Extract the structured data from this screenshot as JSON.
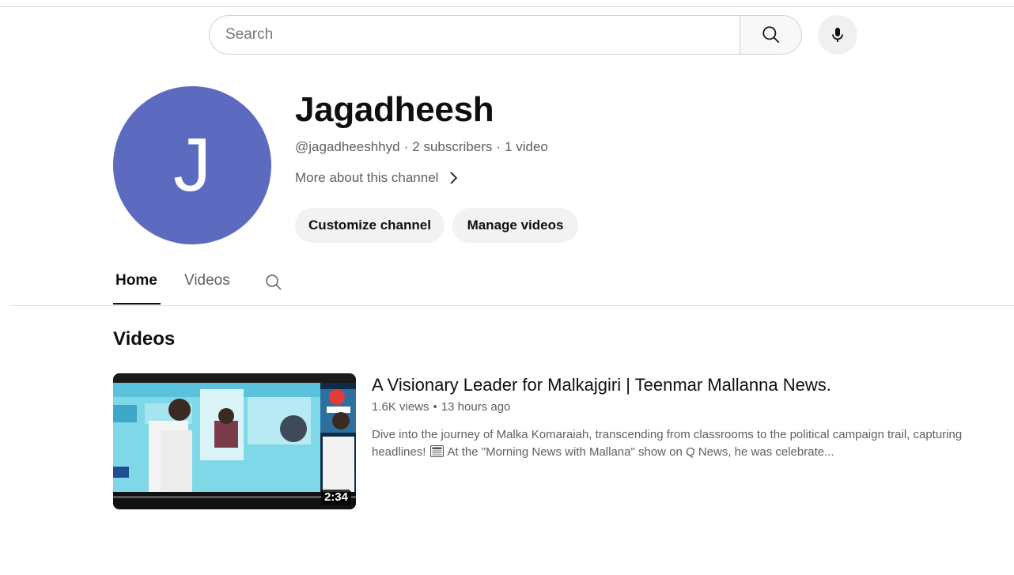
{
  "search": {
    "placeholder": "Search"
  },
  "icons": {
    "search": "search-icon",
    "mic": "microphone-icon",
    "chevron": "chevron-right-icon",
    "tab_search": "search-icon",
    "news": "newspaper-icon"
  },
  "channel": {
    "avatar_letter": "J",
    "avatar_color": "#5c6bc0",
    "name": "Jagadheesh",
    "handle": "@jagadheeshhyd",
    "subscribers": "2 subscribers",
    "video_count": "1 video",
    "more_about": "More about this channel",
    "customize_label": "Customize channel",
    "manage_label": "Manage videos"
  },
  "tabs": [
    {
      "label": "Home",
      "active": true
    },
    {
      "label": "Videos",
      "active": false
    }
  ],
  "section": {
    "title": "Videos"
  },
  "video": {
    "title": "A Visionary Leader for Malkajgiri | Teenmar Mallanna News.",
    "views": "1.6K views",
    "age": "13 hours ago",
    "duration": "2:34",
    "description_part1": "Dive into the journey of Malka Komaraiah, transcending from classrooms to the political campaign trail, capturing headlines!",
    "description_part2": "At the \"Morning News with Mallana\" show on Q News, he was celebrate..."
  }
}
